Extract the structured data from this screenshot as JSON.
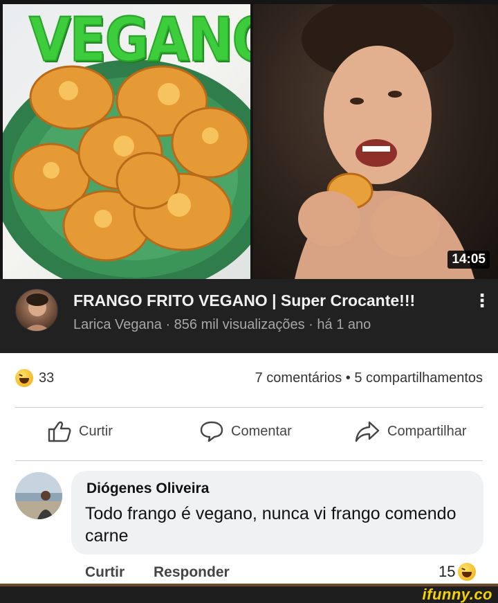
{
  "thumbnail": {
    "overlay_text": "VEGANO",
    "duration": "14:05"
  },
  "video": {
    "title": "FRANGO FRITO VEGANO | Super Crocante!!!",
    "meta": "Larica Vegana · 856 mil visualizações · há 1 ano",
    "more_icon": "⋮"
  },
  "reactions": {
    "icon": "laughing-emoji",
    "count": "33",
    "summary": "7 comentários • 5 compartilhamentos"
  },
  "actions": {
    "like_label": "Curtir",
    "comment_label": "Comentar",
    "share_label": "Compartilhar"
  },
  "comment": {
    "author": "Diógenes Oliveira",
    "text": "Todo frango é vegano, nunca vi frango comendo carne",
    "like_link": "Curtir",
    "reply_link": "Responder",
    "reaction_count": "15"
  },
  "watermark": "ifunny.co"
}
